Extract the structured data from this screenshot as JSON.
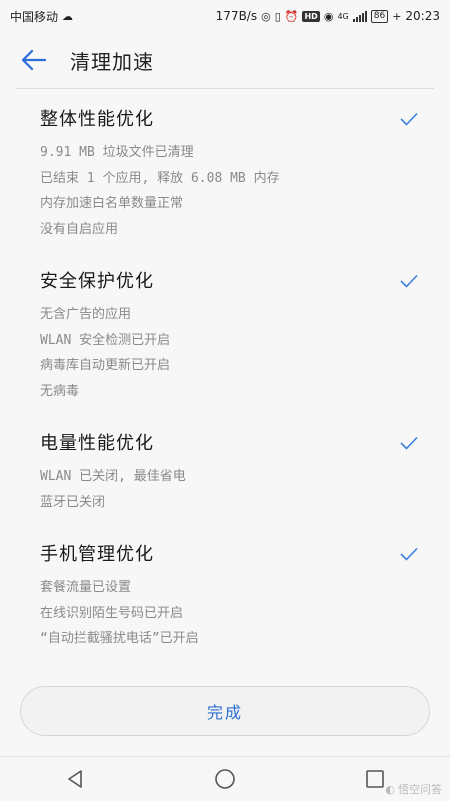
{
  "status_bar": {
    "carrier": "中国移动",
    "speed": "177B/s",
    "net_type": "4G",
    "hd_label": "HD",
    "battery": "86",
    "time": "20:23"
  },
  "header": {
    "title": "清理加速"
  },
  "sections": [
    {
      "title": "整体性能优化",
      "items": [
        "9.91 MB 垃圾文件已清理",
        "已结束 1 个应用, 释放 6.08 MB 内存",
        "内存加速白名单数量正常",
        "没有自启应用"
      ]
    },
    {
      "title": "安全保护优化",
      "items": [
        "无含广告的应用",
        "WLAN 安全检测已开启",
        "病毒库自动更新已开启",
        "无病毒"
      ]
    },
    {
      "title": "电量性能优化",
      "items": [
        "WLAN 已关闭, 最佳省电",
        "蓝牙已关闭"
      ]
    },
    {
      "title": "手机管理优化",
      "items": [
        "套餐流量已设置",
        "在线识别陌生号码已开启",
        "“自动拦截骚扰电话”已开启"
      ]
    }
  ],
  "done_button": {
    "label": "完成"
  },
  "watermark": {
    "text": "悟空问答"
  },
  "colors": {
    "accent": "#2a6dd6",
    "check": "#3d7fe0",
    "muted_text": "#8a8a8a"
  }
}
